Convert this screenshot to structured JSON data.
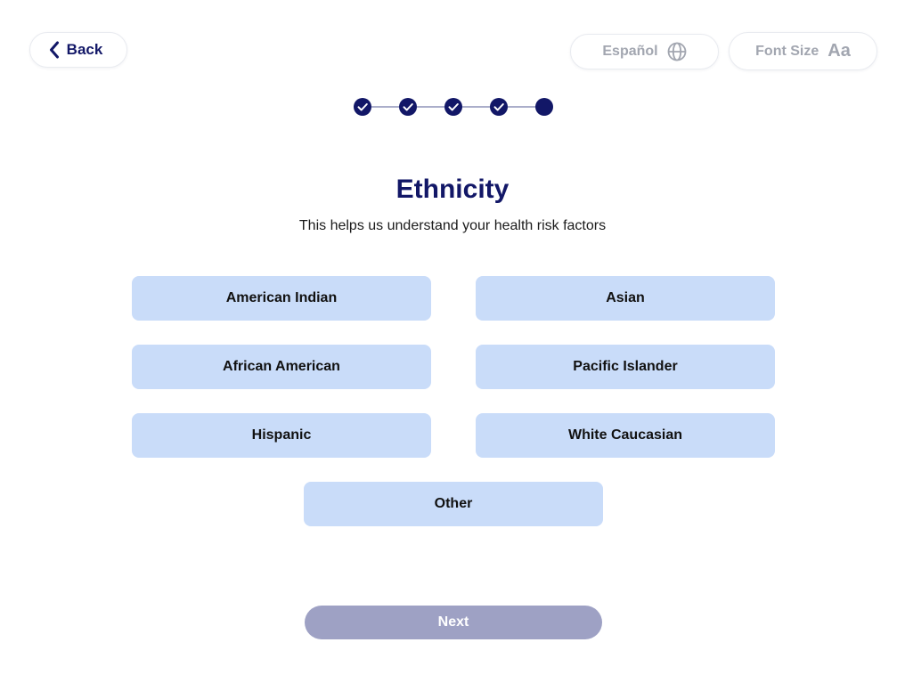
{
  "header": {
    "back_label": "Back",
    "language_label": "Español",
    "font_size_label": "Font Size",
    "font_size_glyph": "Aa",
    "icons": {
      "back": "chevron-left-icon",
      "language": "globe-icon"
    }
  },
  "progress": {
    "total_steps": 5,
    "completed_steps": 4,
    "current_step": 5
  },
  "main": {
    "title": "Ethnicity",
    "subtitle": "This helps us understand your health risk factors",
    "options": [
      {
        "label": "American Indian"
      },
      {
        "label": "Asian"
      },
      {
        "label": "African American"
      },
      {
        "label": "Pacific Islander"
      },
      {
        "label": "Hispanic"
      },
      {
        "label": "White Caucasian"
      },
      {
        "label": "Other"
      }
    ]
  },
  "footer": {
    "next_label": "Next",
    "next_enabled": false
  },
  "colors": {
    "brand_navy": "#121767",
    "option_bg": "#c9dcf9",
    "next_disabled_bg": "#9ea1c4",
    "muted_text": "#a2a6b0"
  }
}
